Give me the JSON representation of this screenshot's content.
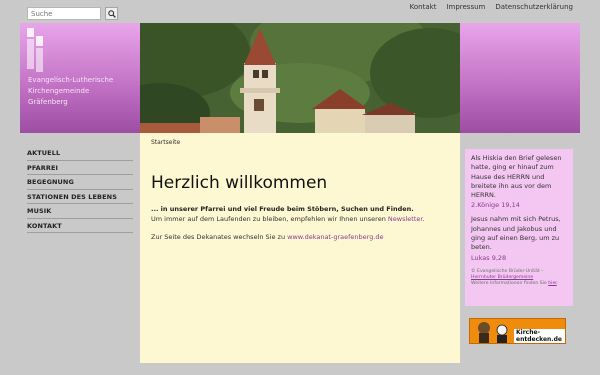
{
  "search": {
    "placeholder": "Suche",
    "icon": "search-icon"
  },
  "topnav": {
    "items": [
      "Kontakt",
      "Impressum",
      "Datenschutzerklärung"
    ]
  },
  "header": {
    "org_lines": [
      "Evangelisch-Lutherische",
      "Kirchengemeinde",
      "Gräfenberg"
    ]
  },
  "sidebar": {
    "items": [
      "AKTUELL",
      "PFARREI",
      "BEGEGNUNG",
      "STATIONEN DES LEBENS",
      "MUSIK",
      "KONTAKT"
    ]
  },
  "main": {
    "breadcrumb": "Startseite",
    "title": "Herzlich willkommen",
    "intro_strong": "... in unserer Pfarrei und viel Freude beim Stöbern, Suchen und Finden.",
    "intro_text": "Um immer auf dem Laufenden zu bleiben, empfehlen wir Ihnen unseren ",
    "newsletter_link": "Newsletter",
    "intro_end": ".",
    "dekanat_text": "Zur Seite des Dekanates wechseln Sie zu ",
    "dekanat_link": "www.dekanat-graefenberg.de"
  },
  "verses": {
    "verse1": "Als Hiskia den Brief gelesen hatte, ging er hinauf zum Hause des HERRN und breitete ihn aus vor dem HERRN.",
    "ref1": "2.Könige 19,14",
    "verse2": "Jesus nahm mit sich Petrus, Johannes und Jakobus und ging auf einen Berg, um zu beten.",
    "ref2": "Lukas 9,28",
    "credit_line1": "© Evangelische Brüder-Unität –",
    "credit_link": "Herrnhuter Brüdergemeine",
    "credit_line3": "Weitere Informationen finden Sie ",
    "credit_here": "hier",
    "credit_end": "."
  },
  "banner": {
    "text": "Kirche-entdecken.de"
  },
  "colors": {
    "header_gradient_top": "#e8a6ea",
    "header_gradient_bottom": "#9c4ea2",
    "content_bg": "#fdf8d2",
    "verse_bg": "#f3c7f1",
    "link": "#8a3c8f"
  }
}
